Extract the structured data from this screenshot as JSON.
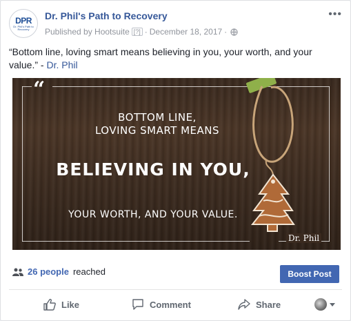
{
  "post": {
    "page_name": "Dr. Phil's Path to Recovery",
    "avatar_logo": "DPR",
    "avatar_logo_sub": "Dr. Phil's Path to Recovery",
    "published_by": "Published by Hootsuite",
    "help_marker": "[?]",
    "separator": "·",
    "date": "December 18, 2017",
    "separator2": "·",
    "more_label": "•••",
    "text_quote": "“Bottom line, loving smart means believing in you, your worth, and your value.” - ",
    "text_link": "Dr. Phil"
  },
  "image": {
    "quote_mark": "“",
    "line1": "BOTTOM LINE,",
    "line2": "LOVING SMART MEANS",
    "line3": "BELIEVING IN YOU,",
    "line4": "YOUR WORTH, AND YOUR VALUE.",
    "signature": "Dr. Phil"
  },
  "reach": {
    "count_label": "26 people",
    "suffix": "reached"
  },
  "boost_label": "Boost Post",
  "actions": {
    "like": "Like",
    "comment": "Comment",
    "share": "Share"
  },
  "colors": {
    "link_blue": "#365899",
    "button_blue": "#4267b2",
    "muted": "#90949c"
  },
  "icons": [
    "people-icon",
    "like-icon",
    "comment-icon",
    "share-icon",
    "globe-icon",
    "more-icon",
    "caret-down-icon"
  ]
}
